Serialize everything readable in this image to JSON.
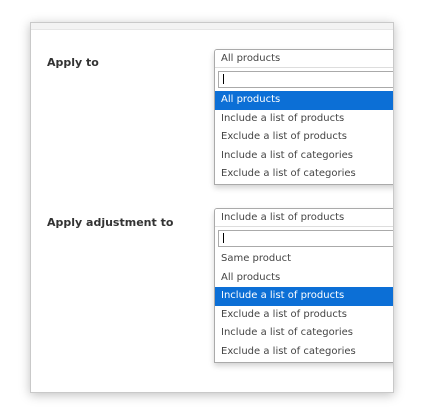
{
  "apply_to": {
    "label": "Apply to",
    "current": "All products",
    "search_value": "",
    "options": [
      {
        "label": "All products",
        "selected": true
      },
      {
        "label": "Include a list of products",
        "selected": false
      },
      {
        "label": "Exclude a list of products",
        "selected": false
      },
      {
        "label": "Include a list of categories",
        "selected": false
      },
      {
        "label": "Exclude a list of categories",
        "selected": false
      }
    ]
  },
  "apply_adjustment_to": {
    "label": "Apply adjustment to",
    "current": "Include a list of products",
    "search_value": "",
    "options": [
      {
        "label": "Same product",
        "selected": false
      },
      {
        "label": "All products",
        "selected": false
      },
      {
        "label": "Include a list of products",
        "selected": true
      },
      {
        "label": "Exclude a list of products",
        "selected": false
      },
      {
        "label": "Include a list of categories",
        "selected": false
      },
      {
        "label": "Exclude a list of categories",
        "selected": false
      }
    ]
  },
  "colors": {
    "selected_bg": "#0c6fd6",
    "selected_text": "#ffffff"
  }
}
